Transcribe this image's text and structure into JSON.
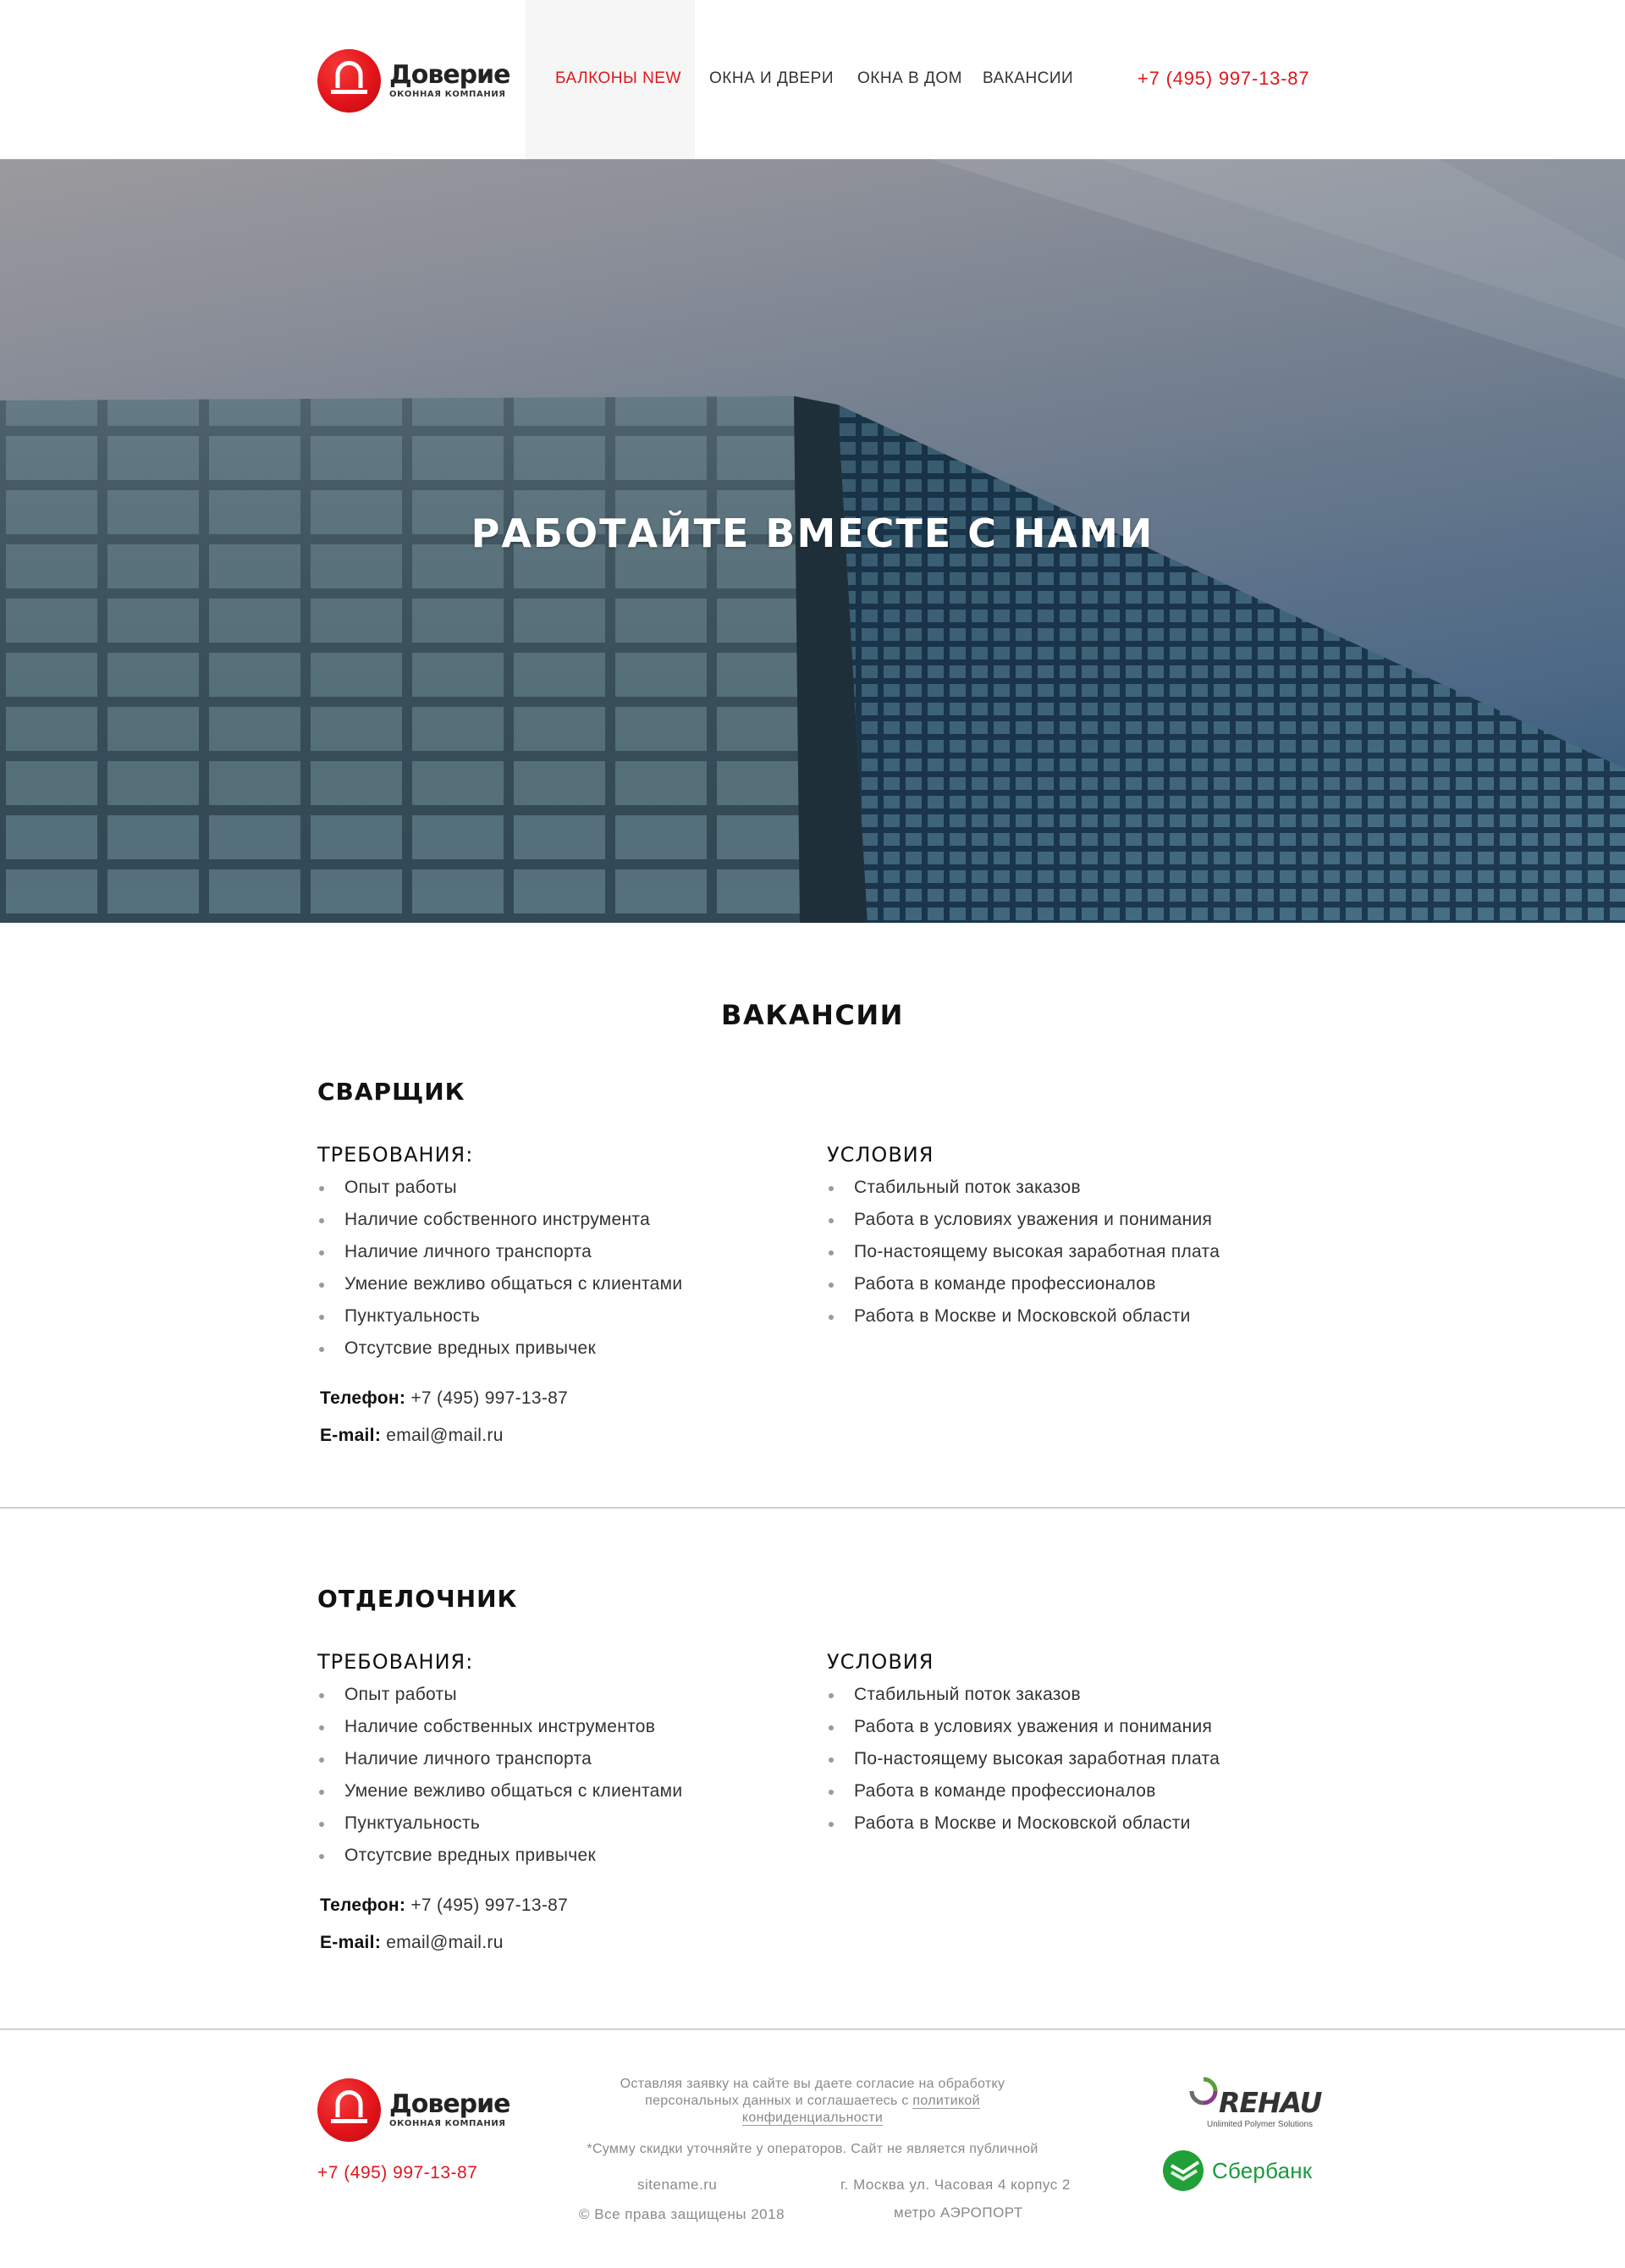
{
  "header": {
    "logo_title": "Доверие",
    "logo_subtitle": "ОКОННАЯ КОМПАНИЯ",
    "nav": [
      {
        "label": "БАЛКОНЫ  NEW",
        "active": true
      },
      {
        "label": "ОКНА И ДВЕРИ",
        "active": false
      },
      {
        "label": "ОКНА В ДОМ",
        "active": false
      },
      {
        "label": "ВАКАНСИИ",
        "active": false
      }
    ],
    "phone": "+7 (495) 997-13-87"
  },
  "hero": {
    "title": "РАБОТАЙТЕ ВМЕСТЕ С НАМИ"
  },
  "vacancies_title": "ВАКАНСИИ",
  "vacancies": [
    {
      "title": "СВАРЩИК",
      "requirements_title": "ТРЕБОВАНИЯ:",
      "requirements": [
        "Опыт работы",
        "Наличие собственного инструмента",
        "Наличие личного транспорта",
        "Умение вежливо общаться с клиентами",
        "Пунктуальность",
        "Отсутсвие вредных привычек"
      ],
      "conditions_title": "УСЛОВИЯ",
      "conditions": [
        "Стабильный поток заказов",
        "Работа в условиях уважения и понимания",
        "По-настоящему высокая заработная плата",
        "Работа в команде профессионалов",
        "Работа в Москве и Московской области"
      ],
      "phone_label": "Телефон:",
      "phone": "+7 (495) 997-13-87",
      "email_label": "E-mail:",
      "email": "email@mail.ru"
    },
    {
      "title": "ОТДЕЛОЧНИК",
      "requirements_title": "ТРЕБОВАНИЯ:",
      "requirements": [
        "Опыт работы",
        "Наличие собственных инструментов",
        "Наличие личного транспорта",
        "Умение вежливо общаться с клиентами",
        "Пунктуальность",
        "Отсутсвие вредных привычек"
      ],
      "conditions_title": "УСЛОВИЯ",
      "conditions": [
        "Стабильный поток заказов",
        "Работа в условиях уважения и понимания",
        "По-настоящему высокая заработная плата",
        "Работа в команде профессионалов",
        "Работа в Москве и Московской области"
      ],
      "phone_label": "Телефон:",
      "phone": "+7 (495) 997-13-87",
      "email_label": "E-mail:",
      "email": "email@mail.ru"
    }
  ],
  "footer": {
    "logo_title": "Доверие",
    "logo_subtitle": "ОКОННАЯ КОМПАНИЯ",
    "phone": "+7 (495) 997-13-87",
    "consent_text": "Оставляя заявку на сайте вы даете согласие на обработку персональных данных и соглашаетесь с",
    "policy_link": "политикой конфиденциальности",
    "note": "*Сумму скидки уточняйте у операторов. Сайт не является публичной",
    "site": "sitename.ru",
    "copyright": "© Все права защищены 2018",
    "address": "г. Москва ул. Часовая 4 корпус 2",
    "metro": "метро АЭРОПОРТ",
    "partner1": "REHAU",
    "partner1_sub": "Unlimited Polymer Solutions",
    "partner2": "Сбербанк"
  },
  "colors": {
    "accent": "#e0161b",
    "sber_green": "#1a9a3c"
  }
}
